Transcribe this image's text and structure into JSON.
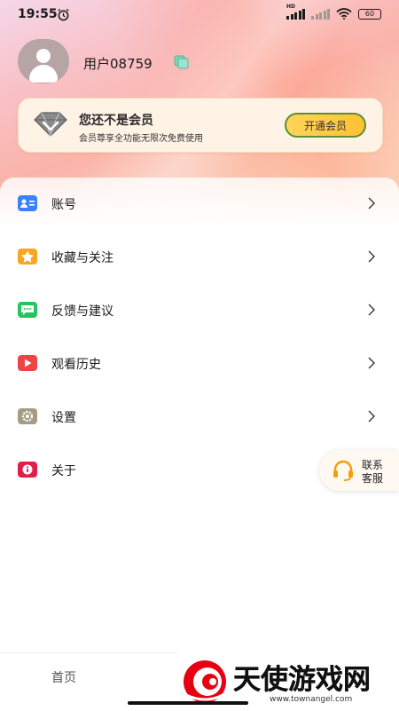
{
  "status_bar": {
    "time": "19:55",
    "battery": "60",
    "network_label": "HD"
  },
  "profile": {
    "username": "用户08759"
  },
  "vip": {
    "title": "您还不是会员",
    "subtitle": "会员尊享全功能无限次免费使用",
    "button_label": "开通会员"
  },
  "menu": {
    "items": [
      {
        "label": "账号",
        "icon": "account-card-icon",
        "color": "#3b82f6"
      },
      {
        "label": "收藏与关注",
        "icon": "star-icon",
        "color": "#f5a623"
      },
      {
        "label": "反馈与建议",
        "icon": "chat-bubble-icon",
        "color": "#22c55e"
      },
      {
        "label": "观看历史",
        "icon": "play-icon",
        "color": "#ef4444"
      },
      {
        "label": "设置",
        "icon": "gear-icon",
        "color": "#a59d83"
      },
      {
        "label": "关于",
        "icon": "info-icon",
        "color": "#e11d48"
      }
    ]
  },
  "support": {
    "label": "联系客服"
  },
  "tabbar": {
    "home_label": "首页"
  },
  "watermark": {
    "text": "天使游戏网",
    "url": "www.townangel.com"
  }
}
